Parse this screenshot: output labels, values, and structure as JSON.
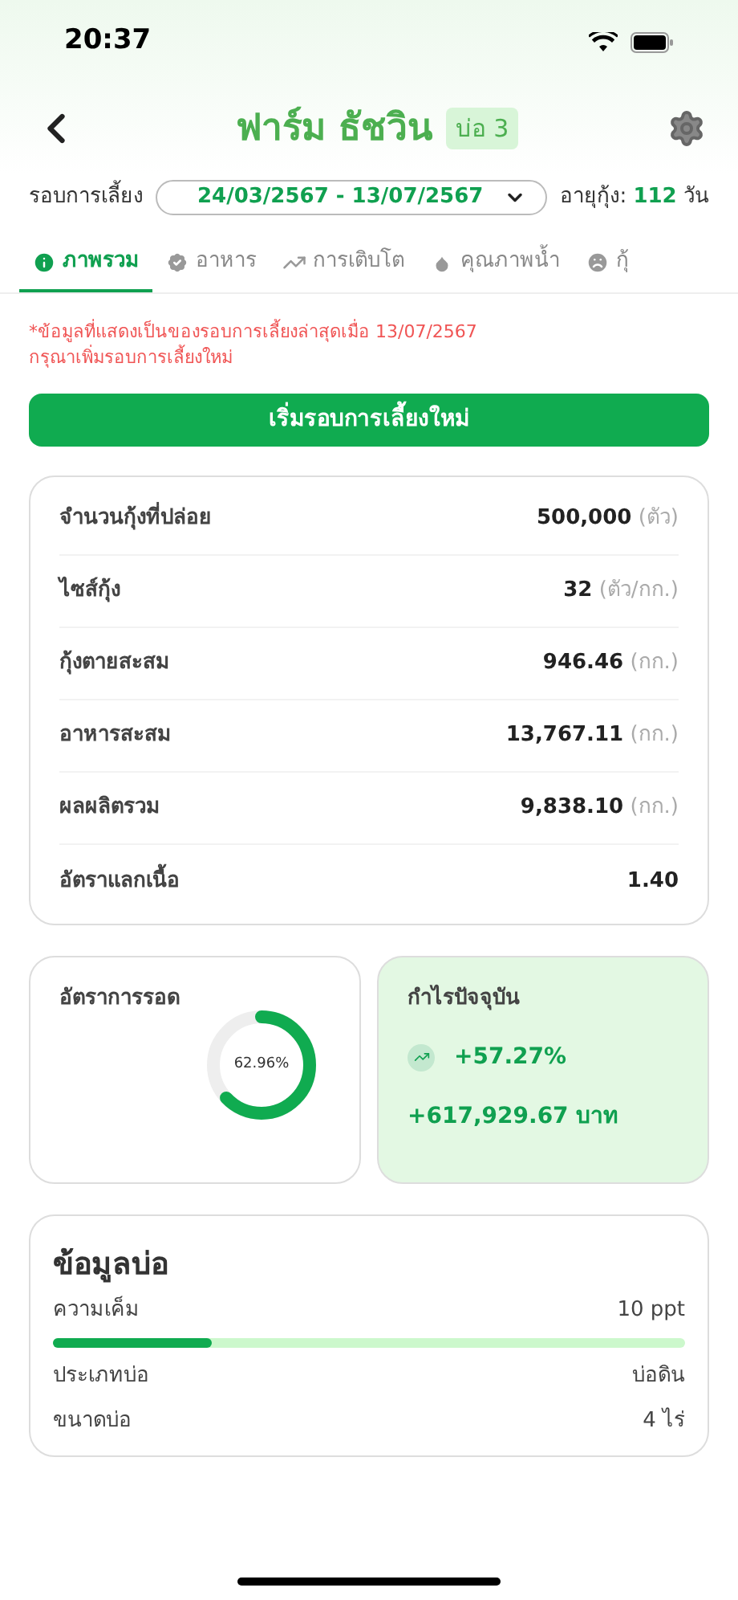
{
  "status_bar": {
    "time": "20:37"
  },
  "header": {
    "title": "ฟาร์ม ธัชวิน",
    "pond_badge": "บ่อ 3"
  },
  "cycle": {
    "label": "รอบการเลี้ยง",
    "value": "24/03/2567 - 13/07/2567",
    "age_label": "อายุกุ้ง:",
    "age_value": "112",
    "age_unit": "วัน"
  },
  "tabs": [
    {
      "label": "ภาพรวม",
      "selected": true
    },
    {
      "label": "อาหาร",
      "selected": false
    },
    {
      "label": "การเติบโต",
      "selected": false
    },
    {
      "label": "คุณภาพน้ำ",
      "selected": false
    },
    {
      "label": "กุ้",
      "selected": false
    }
  ],
  "notice": [
    "*ข้อมูลที่แสดงเป็นของรอบการเลี้ยงล่าสุดเมื่อ 13/07/2567",
    "กรุณาเพิ่มรอบการเลี้ยงใหม่"
  ],
  "new_cycle_button": "เริ่มรอบการเลี้ยงใหม่",
  "summary": [
    {
      "label": "จำนวนกุ้งที่ปล่อย",
      "value": "500,000",
      "unit": "(ตัว)"
    },
    {
      "label": "ไซส์กุ้ง",
      "value": "32",
      "unit": "(ตัว/กก.)"
    },
    {
      "label": "กุ้งตายสะสม",
      "value": "946.46",
      "unit": "(กก.)"
    },
    {
      "label": "อาหารสะสม",
      "value": "13,767.11",
      "unit": "(กก.)"
    },
    {
      "label": "ผลผลิตรวม",
      "value": "9,838.10",
      "unit": "(กก.)"
    },
    {
      "label": "อัตราแลกเนื้อ",
      "value": "1.40"
    }
  ],
  "survival": {
    "title": "อัตราการรอด",
    "reading": "62.96%"
  },
  "profit": {
    "title": "กำไรปัจจุบัน",
    "percent": "+57.27%",
    "amount": "+617,929.67 บาท"
  },
  "pond_info": {
    "title": "ข้อมูลบ่อ",
    "salinity_label": "ความเค็ม",
    "salinity_value": "10 ppt",
    "level": 0.25,
    "rows": [
      {
        "label": "ประเภทบ่อ",
        "value": "บ่อดิน"
      },
      {
        "label": "ขนาดบ่อ",
        "value": "4 ไร่"
      }
    ]
  }
}
